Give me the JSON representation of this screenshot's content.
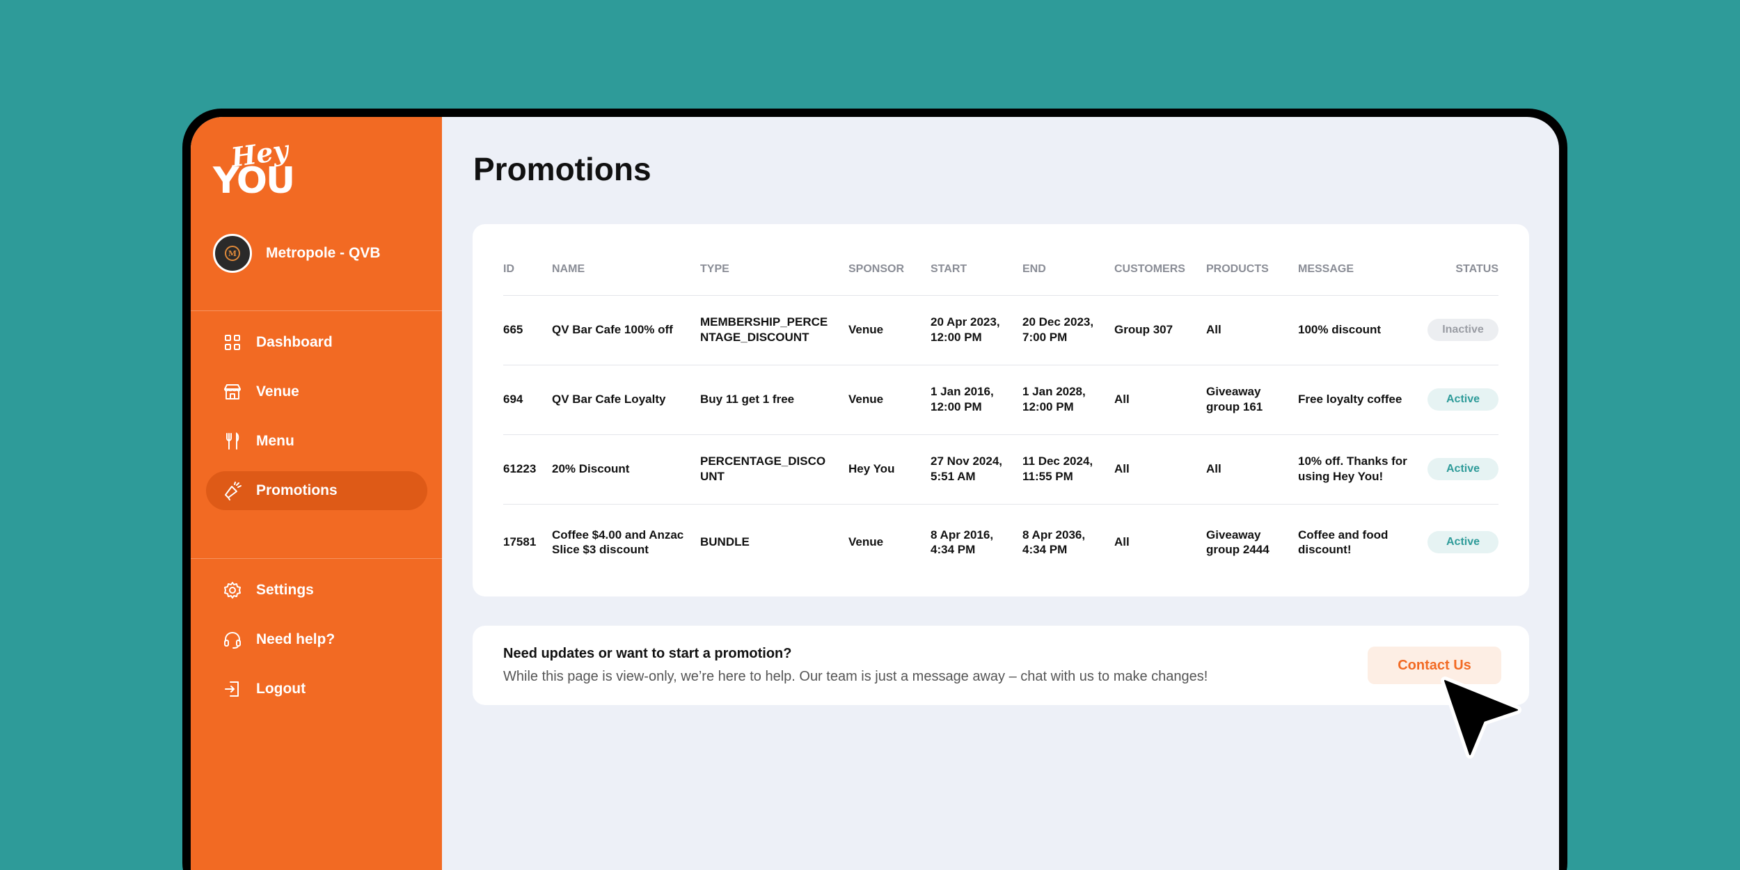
{
  "brand": {
    "logo_top": "Hey",
    "logo_bottom": "YOU"
  },
  "venue": {
    "name": "Metropole - QVB"
  },
  "nav": {
    "main": [
      {
        "label": "Dashboard",
        "icon": "grid-icon"
      },
      {
        "label": "Venue",
        "icon": "storefront-icon"
      },
      {
        "label": "Menu",
        "icon": "fork-knife-icon"
      },
      {
        "label": "Promotions",
        "icon": "megaphone-icon",
        "active": true
      }
    ],
    "bottom": [
      {
        "label": "Settings",
        "icon": "gear-icon"
      },
      {
        "label": "Need help?",
        "icon": "headset-icon"
      },
      {
        "label": "Logout",
        "icon": "logout-icon"
      }
    ]
  },
  "page": {
    "title": "Promotions"
  },
  "table": {
    "headers": [
      "ID",
      "NAME",
      "TYPE",
      "SPONSOR",
      "START",
      "END",
      "CUSTOMERS",
      "PRODUCTS",
      "MESSAGE",
      "STATUS"
    ],
    "rows": [
      {
        "id": "665",
        "name": "QV Bar Cafe 100% off",
        "type": "MEMBERSHIP_PERCE NTAGE_DISCOUNT",
        "sponsor": "Venue",
        "start": "20 Apr 2023, 12:00 PM",
        "end": "20 Dec 2023, 7:00 PM",
        "customers": "Group 307",
        "products": "All",
        "message": "100% discount",
        "status": "Inactive"
      },
      {
        "id": "694",
        "name": "QV Bar Cafe Loyalty",
        "type": "Buy 11 get 1 free",
        "sponsor": "Venue",
        "start": "1 Jan 2016, 12:00 PM",
        "end": "1 Jan 2028, 12:00 PM",
        "customers": "All",
        "products": "Giveaway group 161",
        "message": "Free loyalty coffee",
        "status": "Active"
      },
      {
        "id": "61223",
        "name": "20% Discount",
        "type": "PERCENTAGE_DISCO UNT",
        "sponsor": "Hey You",
        "start": "27 Nov 2024, 5:51 AM",
        "end": "11 Dec 2024, 11:55 PM",
        "customers": "All",
        "products": "All",
        "message": "10% off. Thanks for using Hey You!",
        "status": "Active"
      },
      {
        "id": "17581",
        "name": "Coffee $4.00 and Anzac Slice $3 discount",
        "type": "BUNDLE",
        "sponsor": "Venue",
        "start": "8 Apr 2016, 4:34 PM",
        "end": "8 Apr 2036, 4:34 PM",
        "customers": "All",
        "products": "Giveaway group 2444",
        "message": "Coffee and food discount!",
        "status": "Active"
      }
    ]
  },
  "help": {
    "title": "Need updates or want to start a promotion?",
    "text": "While this page is view-only, we’re here to help. Our team is just a message away – chat with us to make changes!",
    "button_label": "Contact Us"
  },
  "colors": {
    "background": "#2e9b99",
    "sidebar": "#f26a23",
    "accent": "#f26a23",
    "active_status": "#2e9b99"
  }
}
